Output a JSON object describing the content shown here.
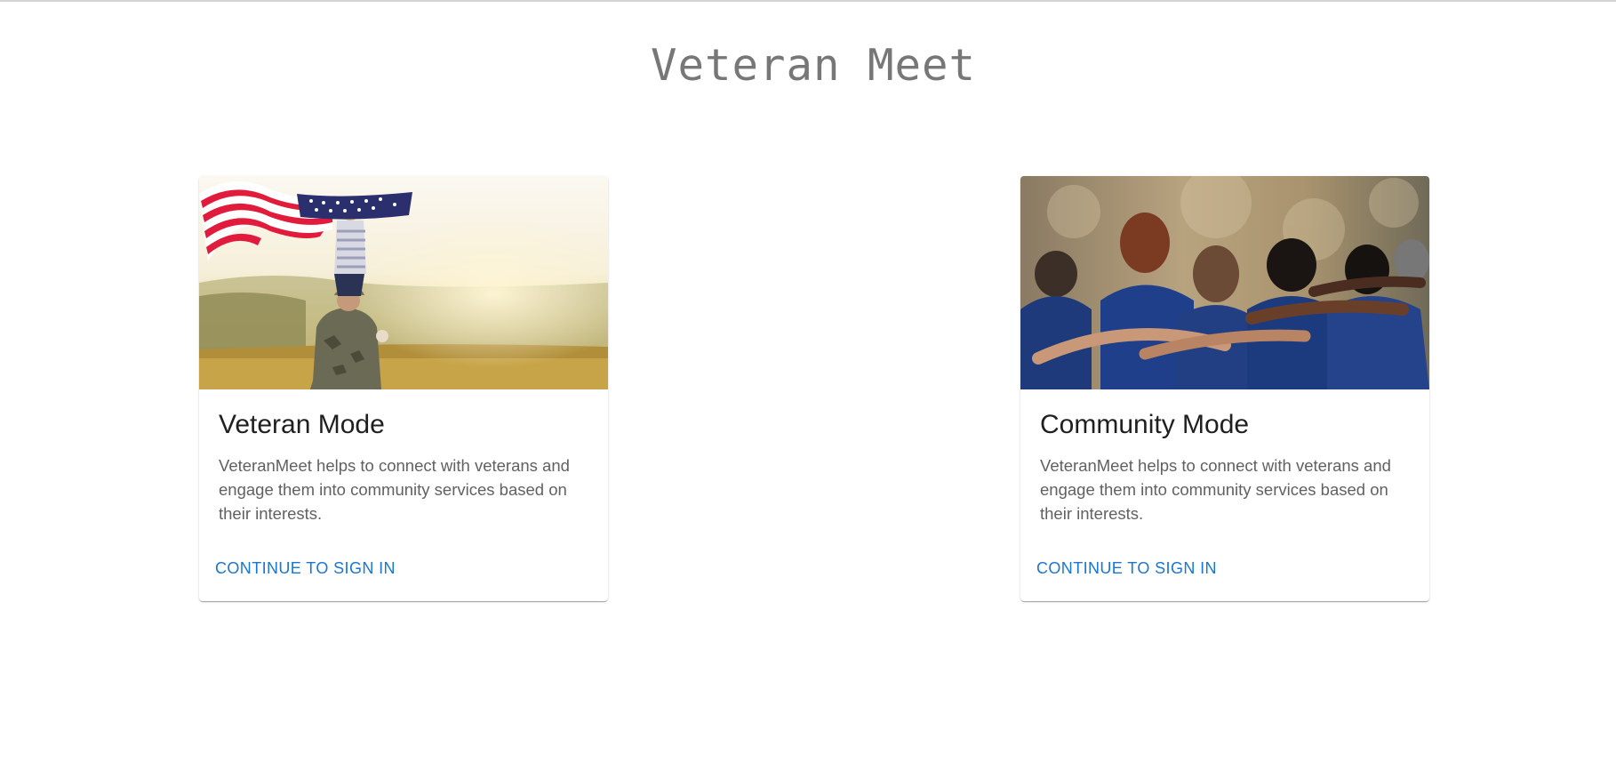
{
  "page": {
    "title": "Veteran Meet"
  },
  "cards": [
    {
      "title": "Veteran Mode",
      "description": "VeteranMeet helps to connect with veterans and engage them into community services based on their interests.",
      "action_label": "CONTINUE TO SIGN IN",
      "image_subject": "soldier carrying child holding american flag in golden field"
    },
    {
      "title": "Community Mode",
      "description": "VeteranMeet helps to connect with veterans and engage them into community services based on their interests.",
      "action_label": "CONTINUE TO SIGN IN",
      "image_subject": "group of people in blue shirts huddling arm in arm outdoors"
    }
  ],
  "colors": {
    "accent": "#1976d2",
    "title_gray": "#777777",
    "body_text": "#616161"
  }
}
